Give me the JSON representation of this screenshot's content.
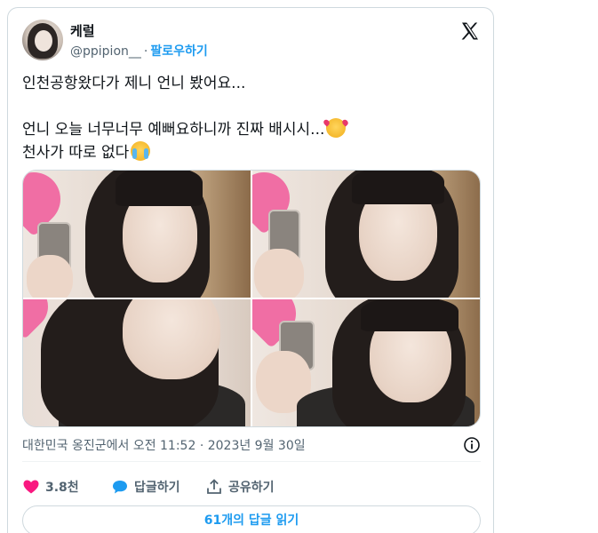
{
  "author": {
    "display_name": "케럴",
    "handle": "@ppipion__",
    "separator": "·",
    "follow_label": "팔로우하기"
  },
  "tweet": {
    "line1": "인천공항왔다가 제니 언니 봤어요...",
    "line2": "언니 오늘 너무너무 예뻐요하니까 진짜 배시시...",
    "line3": "천사가 따로 없다"
  },
  "meta": {
    "location_time": "대한민국 옹진군에서 오전 11:52 · 2023년 9월 30일"
  },
  "actions": {
    "likes_count": "3.8천",
    "reply_label": "답글하기",
    "share_label": "공유하기"
  },
  "replies_button_label": "61개의 답글 읽기",
  "icons": {
    "logo": "x-logo-icon",
    "info": "info-icon",
    "like": "heart-icon",
    "reply": "speech-bubble-icon",
    "share": "share-icon"
  },
  "colors": {
    "link": "#1d9bf0",
    "like": "#f91880",
    "secondary_text": "#536471",
    "border": "#cfd9de"
  }
}
